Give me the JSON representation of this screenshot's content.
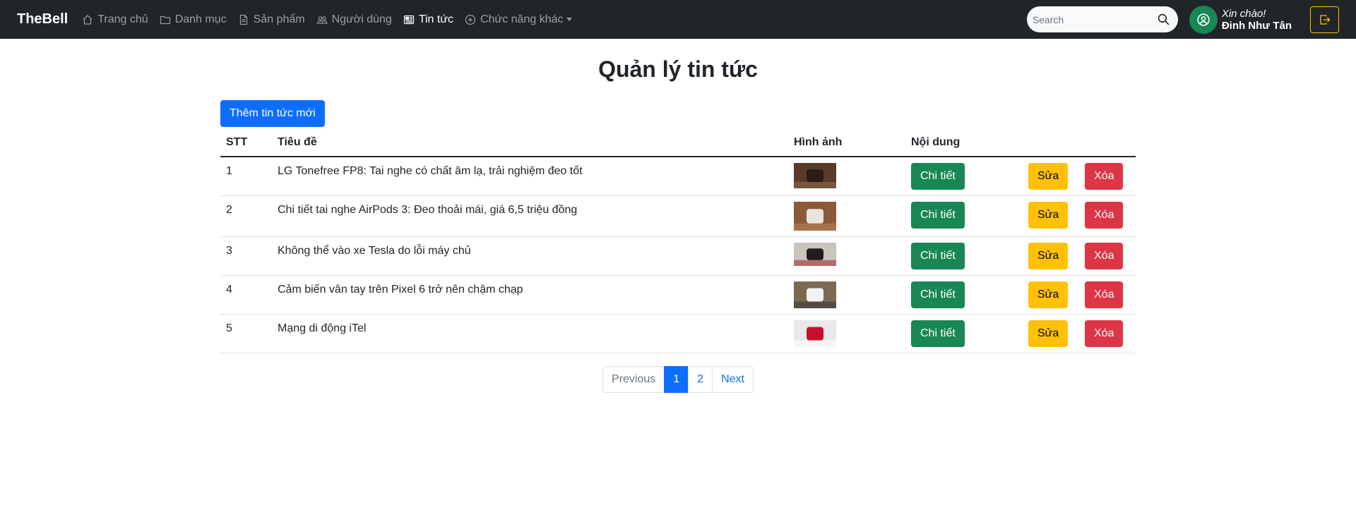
{
  "nav": {
    "brand": "TheBell",
    "items": [
      {
        "label": "Trang chủ",
        "icon": "house-icon"
      },
      {
        "label": "Danh mục",
        "icon": "folder-icon"
      },
      {
        "label": "Sản phẩm",
        "icon": "file-icon"
      },
      {
        "label": "Người dùng",
        "icon": "people-icon"
      },
      {
        "label": "Tin tức",
        "icon": "newspaper-icon",
        "active": true
      },
      {
        "label": "Chức năng khác",
        "icon": "plus-circle-icon",
        "dropdown": true
      }
    ],
    "search_placeholder": "Search",
    "search_value": "",
    "greeting": "Xin chào!",
    "username": "Đinh Như Tân",
    "colors": {
      "navbar": "#212529",
      "avatar": "#198754",
      "logout_border": "#ffc107"
    }
  },
  "main": {
    "title": "Quản lý tin tức",
    "add_button": "Thêm tin tức mới",
    "columns": [
      "STT",
      "Tiêu đề",
      "Hình ảnh",
      "Nội dung"
    ],
    "rows": [
      {
        "stt": "1",
        "title": "LG Tonefree FP8: Tai nghe có chất âm lạ, trải nghiệm đeo tốt",
        "thumb_colors": [
          "#5a3b2a",
          "#2b1d15",
          "#8a6a50"
        ]
      },
      {
        "stt": "2",
        "title": "Chi tiết tai nghe AirPods 3: Đeo thoải mái, giá 6,5 triệu đồng",
        "thumb_colors": [
          "#8a5a3a",
          "#e8e4de",
          "#b8865a"
        ]
      },
      {
        "stt": "3",
        "title": "Không thể vào xe Tesla do lỗi máy chủ",
        "thumb_colors": [
          "#c9c4be",
          "#1e1e1e",
          "#a33030"
        ]
      },
      {
        "stt": "4",
        "title": "Cảm biến vân tay trên Pixel 6 trở nên chậm chạp",
        "thumb_colors": [
          "#7a6a52",
          "#f2f2f2",
          "#3a3a3a"
        ]
      },
      {
        "stt": "5",
        "title": "Mạng di động iTel",
        "thumb_colors": [
          "#e8e8e8",
          "#c8102e",
          "#ffffff"
        ]
      }
    ],
    "detail_label": "Chi tiết",
    "edit_label": "Sửa",
    "delete_label": "Xóa"
  },
  "pagination": {
    "previous": "Previous",
    "pages": [
      "1",
      "2"
    ],
    "current": "1",
    "next": "Next"
  }
}
